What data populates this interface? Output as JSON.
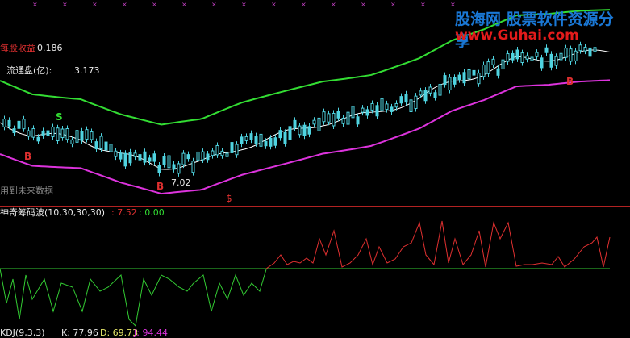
{
  "header": {
    "eps_label": "每股收益",
    "eps_value": "0.186",
    "float_label": "流通盘(亿):",
    "float_value": "3.173",
    "future_note": "用到未来数据",
    "price_marker": "7.02"
  },
  "markers": {
    "sell": "S",
    "buy": "B",
    "dollar": "$"
  },
  "indicator": {
    "name": "神奇筹码波(10,30,30,30)",
    "value_red": ": 7.52",
    "value_green": ": 0.00"
  },
  "bottom_indicator": {
    "name": "KDJ(9,3,3)",
    "k": "K: 77.96",
    "d": "D: 69.73",
    "j": "J: 94.44"
  },
  "watermark": {
    "line1": "股海网 股票软件资源分享",
    "line2": "www.Guhai.com"
  },
  "colors": {
    "background": "#000000",
    "upper_band": "#33dd33",
    "lower_band": "#dd33dd",
    "ma_line": "#ffffff",
    "candle_up": "#4fd3e0",
    "osc_up": "#e03030",
    "osc_down": "#33cc33",
    "label_red": "#e03030"
  }
}
